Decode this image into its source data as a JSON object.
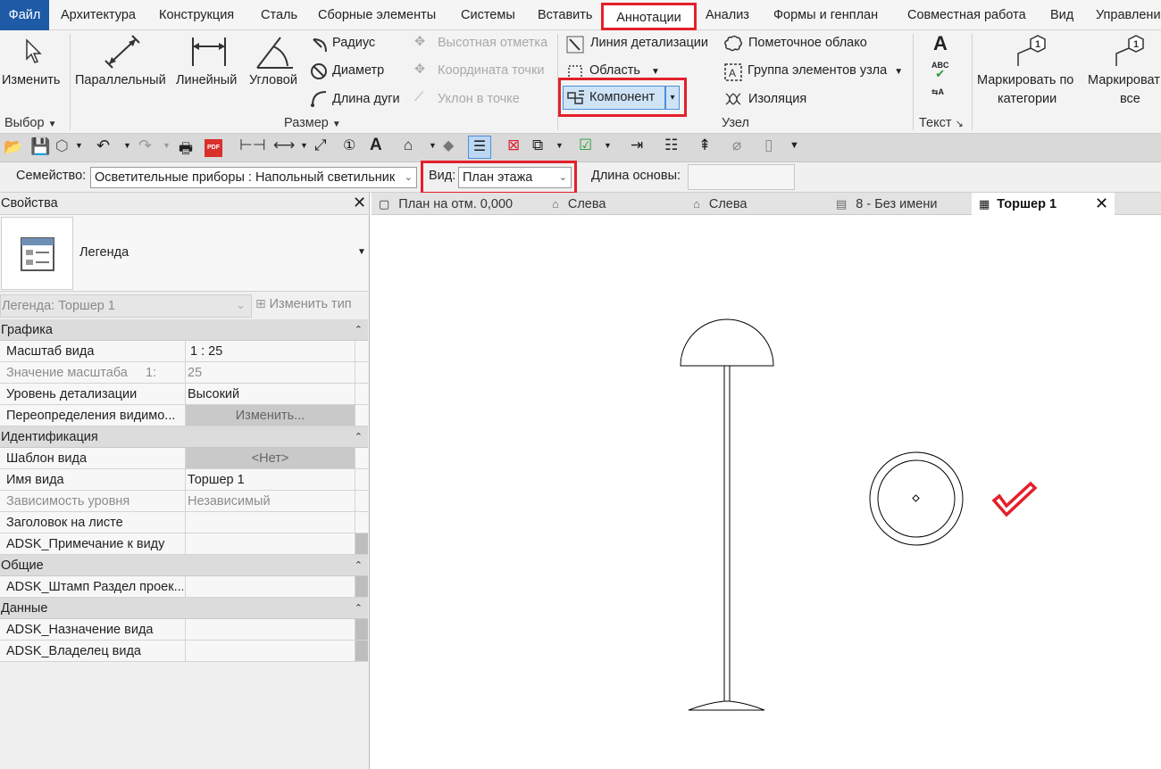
{
  "menu": {
    "items": [
      {
        "label": "Файл"
      },
      {
        "label": "Архитектура"
      },
      {
        "label": "Конструкция"
      },
      {
        "label": "Сталь"
      },
      {
        "label": "Сборные элементы"
      },
      {
        "label": "Системы"
      },
      {
        "label": "Вставить"
      },
      {
        "label": "Аннотации"
      },
      {
        "label": "Анализ"
      },
      {
        "label": "Формы и генплан"
      },
      {
        "label": "Совместная работа"
      },
      {
        "label": "Вид"
      },
      {
        "label": "Управлени"
      }
    ]
  },
  "ribbon": {
    "select": {
      "modify": "Изменить",
      "group": "Выбор"
    },
    "dimension": {
      "aligned": "Параллельный",
      "linear": "Линейный",
      "angular": "Угловой",
      "radius": "Радиус",
      "diameter": "Диаметр",
      "arc_length": "Длина дуги",
      "spot_elevation": "Высотная отметка",
      "spot_coordinate": "Координата точки",
      "spot_slope": "Уклон в точке",
      "group": "Размер"
    },
    "detail": {
      "detail_line": "Линия детализации",
      "region": "Область",
      "component": "Компонент",
      "revision_cloud": "Пометочное облако",
      "detail_group": "Группа элементов узла",
      "insulation": "Изоляция",
      "group": "Узел"
    },
    "text": {
      "group": "Текст"
    },
    "tag": {
      "by_category_1": "Маркировать по",
      "by_category_2": "категории",
      "all_1": "Маркироват",
      "all_2": "все"
    }
  },
  "options_bar": {
    "family_label": "Семейство:",
    "family_value": "Осветительные приборы : Напольный светильник",
    "view_label": "Вид:",
    "view_value": "План этажа",
    "base_length_label": "Длина основы:",
    "base_length_value": ""
  },
  "properties": {
    "title": "Свойства",
    "type_name": "Легенда",
    "instance_selector": "Легенда: Торшер 1",
    "edit_type": "Изменить тип",
    "sections": {
      "graphics": "Графика",
      "identity": "Идентификация",
      "general": "Общие",
      "data": "Данные"
    },
    "rows": {
      "view_scale": {
        "k": "Масштаб вида",
        "v": "1 : 25"
      },
      "scale_value": {
        "k": "Значение масштаба",
        "k2": "1:",
        "v": "25"
      },
      "detail_level": {
        "k": "Уровень детализации",
        "v": "Высокий"
      },
      "vg_overrides": {
        "k": "Переопределения видимо...",
        "v": "Изменить..."
      },
      "view_template": {
        "k": "Шаблон вида",
        "v": "<Нет>"
      },
      "view_name": {
        "k": "Имя вида",
        "v": "Торшер 1"
      },
      "dependency": {
        "k": "Зависимость уровня",
        "v": "Независимый"
      },
      "title_on_sheet": {
        "k": "Заголовок на листе",
        "v": ""
      },
      "adsk_note": {
        "k": "ADSK_Примечание к виду",
        "v": ""
      },
      "adsk_stamp": {
        "k": "ADSK_Штамп Раздел проек...",
        "v": ""
      },
      "adsk_purpose": {
        "k": "ADSK_Назначение вида",
        "v": ""
      },
      "adsk_owner": {
        "k": "ADSK_Владелец вида",
        "v": ""
      }
    }
  },
  "tabs": [
    {
      "label": "План на отм. 0,000"
    },
    {
      "label": "Слева"
    },
    {
      "label": "Слева"
    },
    {
      "label": "8 - Без имени"
    },
    {
      "label": "Торшер 1"
    }
  ],
  "colors": {
    "highlight": "#e3202a",
    "file_menu": "#1f5aa6"
  }
}
